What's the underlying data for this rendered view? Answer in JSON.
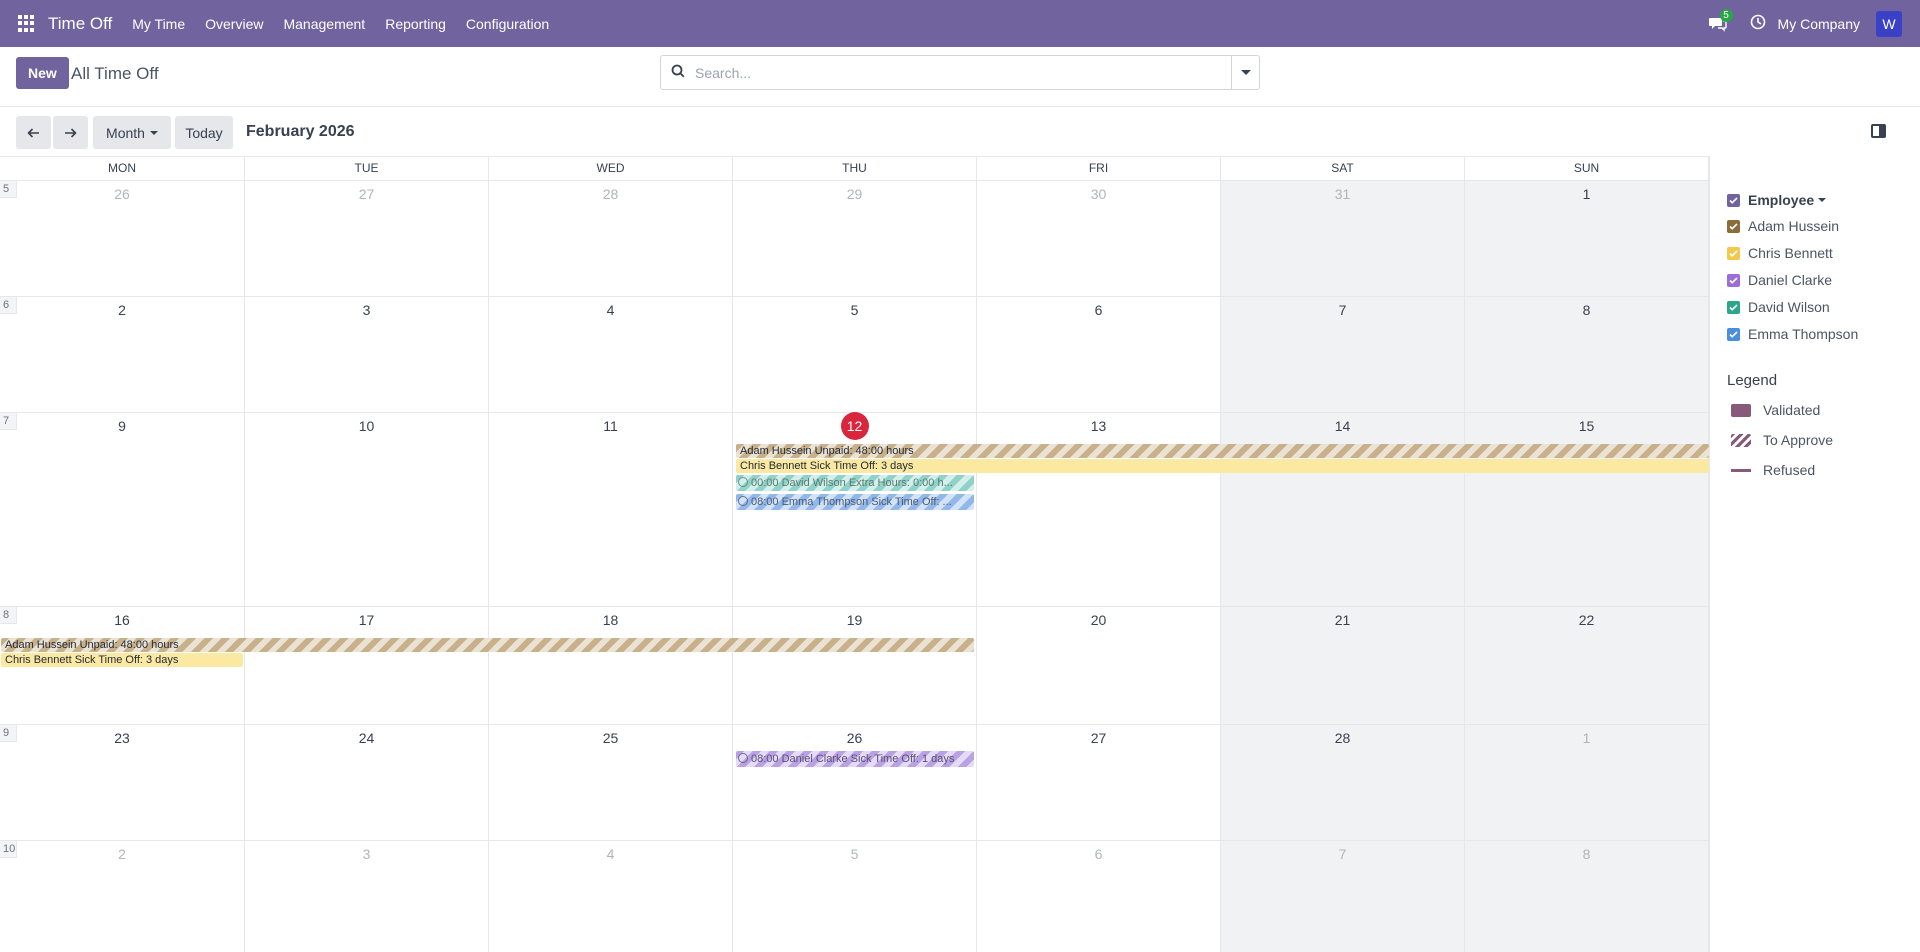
{
  "nav": {
    "app_name": "Time Off",
    "menu": [
      "My Time",
      "Overview",
      "Management",
      "Reporting",
      "Configuration"
    ],
    "messages_count": "5",
    "company": "My Company",
    "avatar_letter": "W"
  },
  "control": {
    "new_label": "New",
    "breadcrumb": "All Time Off",
    "search_placeholder": "Search...",
    "scale_label": "Month",
    "today_label": "Today",
    "period": "February 2026"
  },
  "calendar": {
    "days": [
      "MON",
      "TUE",
      "WED",
      "THU",
      "FRI",
      "SAT",
      "SUN"
    ],
    "weeks": [
      {
        "num": "5",
        "dates": [
          "26",
          "27",
          "28",
          "29",
          "30",
          "31",
          "1"
        ]
      },
      {
        "num": "6",
        "dates": [
          "2",
          "3",
          "4",
          "5",
          "6",
          "7",
          "8"
        ]
      },
      {
        "num": "7",
        "dates": [
          "9",
          "10",
          "11",
          "12",
          "13",
          "14",
          "15"
        ]
      },
      {
        "num": "8",
        "dates": [
          "16",
          "17",
          "18",
          "19",
          "20",
          "21",
          "22"
        ]
      },
      {
        "num": "9",
        "dates": [
          "23",
          "24",
          "25",
          "26",
          "27",
          "28",
          "1"
        ]
      },
      {
        "num": "10",
        "dates": [
          "2",
          "3",
          "4",
          "5",
          "6",
          "7",
          "8"
        ]
      }
    ],
    "events": {
      "adam_w7": "Adam Hussein Unpaid: 48:00 hours",
      "chris_w7": "Chris Bennett Sick Time Off: 3 days",
      "david_w7": "00:00 David Wilson Extra Hours: 0:00 h...",
      "emma_w7": "08:00 Emma Thompson Sick Time Off: ...",
      "adam_w8": "Adam Hussein Unpaid: 48:00 hours",
      "chris_w8": "Chris Bennett Sick Time Off: 3 days",
      "daniel_w9": "08:00 Daniel Clarke Sick Time Off: 1 days"
    }
  },
  "filters": {
    "group_label": "Employee",
    "employees": [
      {
        "name": "Adam Hussein",
        "color": "#8b6d3a"
      },
      {
        "name": "Chris Bennett",
        "color": "#f2c94c"
      },
      {
        "name": "Daniel Clarke",
        "color": "#9b6fd6"
      },
      {
        "name": "David Wilson",
        "color": "#2ca58d"
      },
      {
        "name": "Emma Thompson",
        "color": "#4a8ee0"
      }
    ],
    "group_color": "#71639e"
  },
  "legend": {
    "title": "Legend",
    "validated": "Validated",
    "to_approve": "To Approve",
    "refused": "Refused"
  }
}
